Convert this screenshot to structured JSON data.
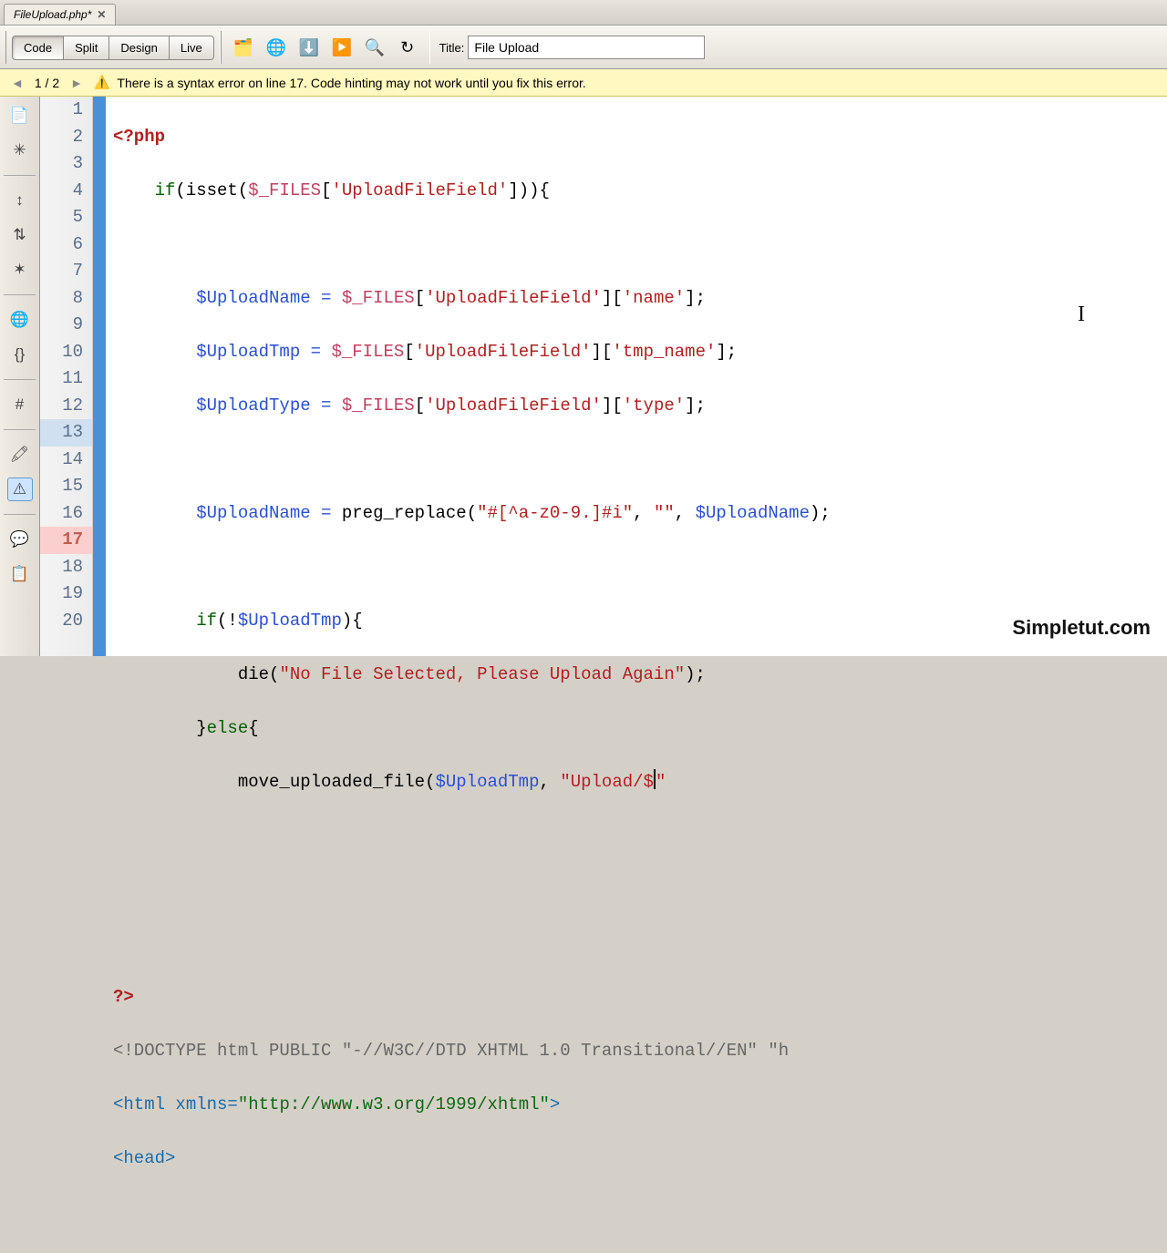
{
  "tab": {
    "filename": "FileUpload.php*"
  },
  "toolbar": {
    "code": "Code",
    "split": "Split",
    "design": "Design",
    "live": "Live",
    "title_label": "Title:",
    "title_value": "File Upload"
  },
  "error": {
    "prev": "◄",
    "pager": "1 / 2",
    "next": "►",
    "msg": "There is a syntax error on line 17.  Code hinting may not work until you fix this error."
  },
  "gutter": {
    "lines": [
      "1",
      "2",
      "3",
      "4",
      "5",
      "6",
      "7",
      "8",
      "9",
      "10",
      "11",
      "12",
      "13",
      "14",
      "15",
      "16",
      "17",
      "18",
      "19",
      "20"
    ]
  },
  "code": {
    "l1_open": "<?php",
    "l2_if": "if",
    "l2_isset": "isset",
    "l2_files": "$_FILES",
    "l2_key": "'UploadFileField'",
    "l4_var": "$UploadName",
    "l4_files": "$_FILES",
    "l4_k1": "'UploadFileField'",
    "l4_k2": "'name'",
    "l5_var": "$UploadTmp",
    "l5_files": "$_FILES",
    "l5_k1": "'UploadFileField'",
    "l5_k2": "'tmp_name'",
    "l6_var": "$UploadType",
    "l6_files": "$_FILES",
    "l6_k1": "'UploadFileField'",
    "l6_k2": "'type'",
    "l8_var": "$UploadName",
    "l8_fn": "preg_replace",
    "l8_s1": "\"#[^a-z0-9.]#i\"",
    "l8_s2": "\"\"",
    "l8_var2": "$UploadName",
    "l10_if": "if",
    "l10_var": "$UploadTmp",
    "l11_fn": "die",
    "l11_str": "\"No File Selected, Please Upload Again\"",
    "l12_else": "else",
    "l13_fn": "move_uploaded_file",
    "l13_var": "$UploadTmp",
    "l13_str": "\"Upload/$",
    "l13_end": "\"",
    "l17_close": "?>",
    "l18": "<!DOCTYPE html PUBLIC \"-//W3C//DTD XHTML 1.0 Transitional//EN\" \"h",
    "l19_open": "<html ",
    "l19_attr": "xmlns=",
    "l19_val": "\"http://www.w3.org/1999/xhtml\"",
    "l19_close": ">",
    "l20": "<head>"
  },
  "watermark": "Simpletut.com"
}
